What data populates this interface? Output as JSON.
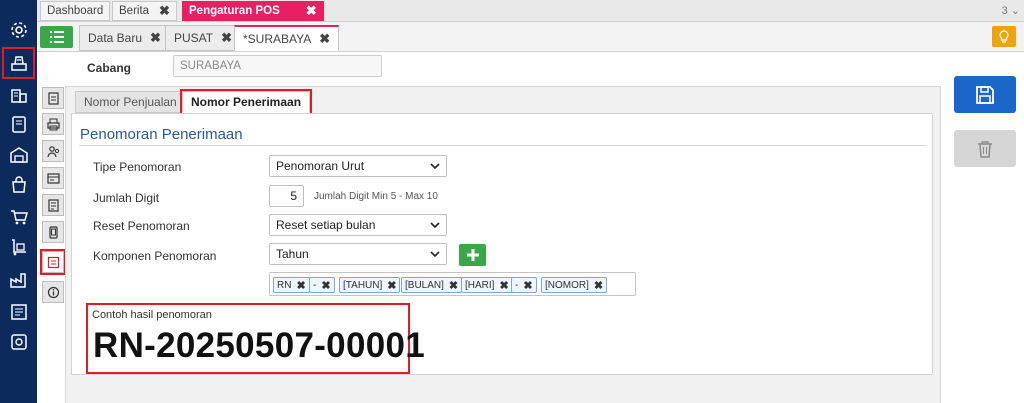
{
  "sidebar": {
    "icons": [
      "gear-icon",
      "cash-register-icon",
      "building-icon",
      "tablet-icon",
      "warehouse-icon",
      "bag-icon",
      "cart-icon",
      "dolly-icon",
      "factory-icon",
      "report-icon",
      "settings-badge-icon"
    ]
  },
  "top_tabs": [
    {
      "label": "Dashboard"
    },
    {
      "label": "Berita",
      "close": "✖"
    },
    {
      "label": "Pengaturan POS",
      "close": "✖"
    }
  ],
  "top_tab_count": "3 ⌄",
  "doc_tabs": [
    {
      "label": "Data Baru",
      "close": "✖"
    },
    {
      "label": "PUSAT",
      "close": "✖"
    },
    {
      "label": "*SURABAYA",
      "close": "✖"
    }
  ],
  "cabang": {
    "label": "Cabang",
    "value": "SURABAYA"
  },
  "sub_tabs": [
    {
      "label": "Nomor Penjualan"
    },
    {
      "label": "Nomor Penerimaan"
    }
  ],
  "section": {
    "title": "Penomoran Penerimaan"
  },
  "form": {
    "tipe": {
      "label": "Tipe Penomoran",
      "value": "Penomoran Urut"
    },
    "digit": {
      "label": "Jumlah Digit",
      "value": "5",
      "hint": "Jumlah Digit Min 5 - Max 10"
    },
    "reset": {
      "label": "Reset Penomoran",
      "value": "Reset setiap bulan"
    },
    "komponen": {
      "label": "Komponen Penomoran",
      "value": "Tahun"
    }
  },
  "chips": [
    {
      "label": "RN",
      "close": "✖"
    },
    {
      "label": "-",
      "close": "✖"
    },
    {
      "label": "[TAHUN]",
      "close": "✖"
    },
    {
      "label": "[BULAN]",
      "close": "✖"
    },
    {
      "label": "[HARI]",
      "close": "✖"
    },
    {
      "label": "-",
      "close": "✖"
    },
    {
      "label": "[NOMOR]",
      "close": "✖"
    }
  ],
  "example": {
    "label": "Contoh hasil penomoran",
    "value": "RN-20250507-00001"
  },
  "colors": {
    "sidebar": "#0d2a5c",
    "active_tab": "#e91e63",
    "primary": "#1a66c9",
    "success": "#3aa84a",
    "highlight": "#e31b23"
  }
}
